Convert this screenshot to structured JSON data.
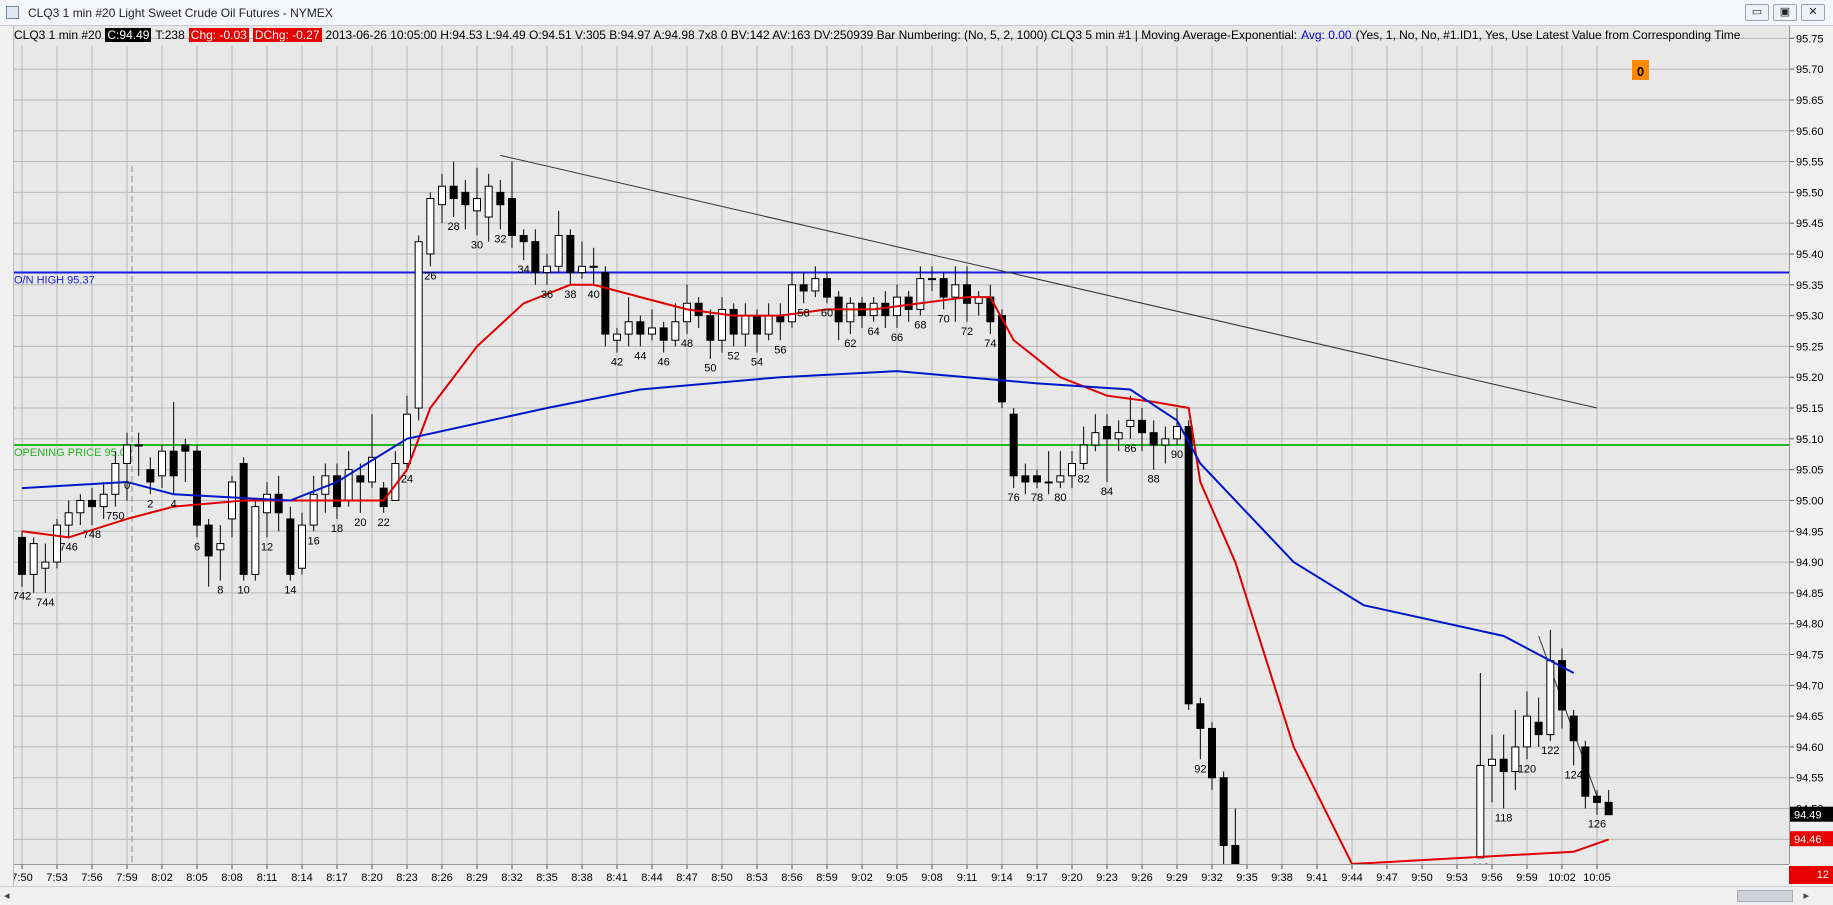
{
  "window": {
    "title": "CLQ3  1 min  #20  Light Sweet Crude Oil Futures - NYMEX",
    "buttons": {
      "minimize": "▭",
      "restore": "▣",
      "close": "✕"
    }
  },
  "infobar": {
    "symbol": "CLQ3  1 min  #20",
    "close": "C:94.49",
    "ticks": "T:238",
    "chg": "Chg: -0.03",
    "dchg": "DChg: -0.27",
    "details": "2013-06-26 10:05:00 H:94.53 L:94.49 O:94.51 V:305 B:94.97 A:94.98 7x8 0 BV:142 AV:163 DV:250939  Bar Numbering:  (No, 5, 2, 1000)  CLQ3  5 min  #1 | Moving Average-Exponential:",
    "avg": "Avg: 0.00",
    "params": "(Yes, 1, No, No, #1.ID1, Yes, Use Latest Value from Corresponding Time"
  },
  "badge": "0",
  "colors": {
    "background": "#e8e8e8",
    "ema_fast": "#e00000",
    "ema_slow": "#0018c8",
    "on_high_line": "#1a1ae0",
    "opening_line": "#22b822",
    "trendline": "#333333",
    "badge": "#ff8a00"
  },
  "price_labels": {
    "last": "94.49",
    "ema": "94.46",
    "xaxis_badge": "12"
  },
  "chart_data": {
    "type": "candlestick",
    "title": "CLQ3  1 min  #20  Light Sweet Crude Oil Futures - NYMEX",
    "ylim": [
      94.41,
      95.77
    ],
    "yticks": [
      95.75,
      95.7,
      95.65,
      95.6,
      95.55,
      95.5,
      95.45,
      95.4,
      95.35,
      95.3,
      95.25,
      95.2,
      95.15,
      95.1,
      95.05,
      95.0,
      94.95,
      94.9,
      94.85,
      94.8,
      94.75,
      94.7,
      94.65,
      94.6,
      94.55,
      94.5,
      94.45
    ],
    "xticks": [
      "7:50",
      "7:53",
      "7:56",
      "7:59",
      "8:02",
      "8:05",
      "8:08",
      "8:11",
      "8:14",
      "8:17",
      "8:20",
      "8:23",
      "8:26",
      "8:29",
      "8:32",
      "8:35",
      "8:38",
      "8:41",
      "8:44",
      "8:47",
      "8:50",
      "8:53",
      "8:56",
      "8:59",
      "9:02",
      "9:05",
      "9:08",
      "9:11",
      "9:14",
      "9:17",
      "9:20",
      "9:23",
      "9:26",
      "9:29",
      "9:32",
      "9:35",
      "9:38",
      "9:41",
      "9:44",
      "9:47",
      "9:50",
      "9:53",
      "9:56",
      "9:59",
      "10:02",
      "10:05"
    ],
    "horizontal_lines": [
      {
        "label": "O/N HIGH",
        "value": 95.37
      },
      {
        "label": "OPENING PRICE",
        "value": 95.09
      }
    ],
    "trendlines": [
      {
        "from": [
          "8:31",
          95.56
        ],
        "to": [
          "10:05",
          95.15
        ]
      },
      {
        "from": [
          "10:00",
          94.78
        ],
        "to": [
          "10:05",
          94.52
        ]
      }
    ],
    "candles": [
      [
        742,
        94.94,
        94.88,
        94.95,
        94.86
      ],
      [
        743,
        94.88,
        94.93,
        94.94,
        94.85
      ],
      [
        744,
        94.89,
        94.9,
        94.93,
        94.85
      ],
      [
        745,
        94.9,
        94.96,
        94.97,
        94.89
      ],
      [
        746,
        94.96,
        94.98,
        95.0,
        94.94
      ],
      [
        747,
        94.98,
        95.0,
        95.01,
        94.96
      ],
      [
        748,
        95.0,
        94.99,
        95.02,
        94.96
      ],
      [
        749,
        94.99,
        95.01,
        95.03,
        94.97
      ],
      [
        750,
        95.01,
        95.06,
        95.08,
        94.99
      ],
      [
        751,
        95.06,
        95.09,
        95.11,
        95.0
      ],
      [
        1,
        95.09,
        95.09,
        95.11,
        95.04
      ],
      [
        2,
        95.05,
        95.03,
        95.07,
        95.01
      ],
      [
        3,
        95.04,
        95.08,
        95.09,
        95.02
      ],
      [
        4,
        95.08,
        95.04,
        95.16,
        95.01
      ],
      [
        5,
        95.09,
        95.08,
        95.1,
        95.03
      ],
      [
        6,
        95.08,
        94.96,
        95.09,
        94.94
      ],
      [
        7,
        94.96,
        94.91,
        94.97,
        94.86
      ],
      [
        8,
        94.92,
        94.93,
        94.96,
        94.87
      ],
      [
        9,
        94.97,
        95.03,
        95.04,
        94.94
      ],
      [
        10,
        95.06,
        94.88,
        95.07,
        94.87
      ],
      [
        11,
        94.88,
        94.99,
        95.0,
        94.87
      ],
      [
        12,
        94.98,
        95.01,
        95.03,
        94.94
      ],
      [
        13,
        95.01,
        94.98,
        95.04,
        94.95
      ],
      [
        14,
        94.97,
        94.88,
        94.99,
        94.87
      ],
      [
        15,
        94.89,
        94.96,
        94.98,
        94.88
      ],
      [
        16,
        94.96,
        95.01,
        95.04,
        94.95
      ],
      [
        17,
        95.01,
        95.04,
        95.06,
        94.98
      ],
      [
        18,
        95.04,
        94.99,
        95.06,
        94.97
      ],
      [
        19,
        95.0,
        95.05,
        95.08,
        94.99
      ],
      [
        20,
        95.04,
        95.03,
        95.06,
        94.98
      ],
      [
        21,
        95.03,
        95.07,
        95.14,
        95.02
      ],
      [
        22,
        95.02,
        94.99,
        95.03,
        94.98
      ],
      [
        23,
        95.0,
        95.06,
        95.08,
        95.0
      ],
      [
        24,
        95.06,
        95.14,
        95.17,
        95.05
      ],
      [
        25,
        95.15,
        95.42,
        95.43,
        95.13
      ],
      [
        26,
        95.4,
        95.49,
        95.5,
        95.38
      ],
      [
        27,
        95.48,
        95.51,
        95.53,
        95.45
      ],
      [
        28,
        95.51,
        95.49,
        95.55,
        95.46
      ],
      [
        29,
        95.5,
        95.48,
        95.52,
        95.44
      ],
      [
        30,
        95.47,
        95.49,
        95.54,
        95.43
      ],
      [
        31,
        95.46,
        95.51,
        95.53,
        95.42
      ],
      [
        32,
        95.5,
        95.48,
        95.52,
        95.44
      ],
      [
        33,
        95.49,
        95.43,
        95.55,
        95.41
      ],
      [
        34,
        95.43,
        95.42,
        95.44,
        95.39
      ],
      [
        35,
        95.42,
        95.37,
        95.44,
        95.35
      ],
      [
        36,
        95.37,
        95.38,
        95.4,
        95.35
      ],
      [
        37,
        95.38,
        95.43,
        95.47,
        95.37
      ],
      [
        38,
        95.43,
        95.37,
        95.44,
        95.35
      ],
      [
        39,
        95.37,
        95.38,
        95.42,
        95.36
      ],
      [
        40,
        95.38,
        95.38,
        95.41,
        95.35
      ],
      [
        41,
        95.37,
        95.27,
        95.38,
        95.25
      ],
      [
        42,
        95.26,
        95.27,
        95.28,
        95.24
      ],
      [
        43,
        95.27,
        95.29,
        95.33,
        95.25
      ],
      [
        44,
        95.29,
        95.27,
        95.3,
        95.25
      ],
      [
        45,
        95.27,
        95.28,
        95.31,
        95.26
      ],
      [
        46,
        95.28,
        95.26,
        95.29,
        95.24
      ],
      [
        47,
        95.26,
        95.29,
        95.32,
        95.25
      ],
      [
        48,
        95.29,
        95.32,
        95.35,
        95.27
      ],
      [
        49,
        95.32,
        95.3,
        95.33,
        95.28
      ],
      [
        50,
        95.3,
        95.26,
        95.31,
        95.23
      ],
      [
        51,
        95.26,
        95.31,
        95.33,
        95.24
      ],
      [
        52,
        95.31,
        95.27,
        95.32,
        95.25
      ],
      [
        53,
        95.27,
        95.3,
        95.32,
        95.25
      ],
      [
        54,
        95.3,
        95.27,
        95.31,
        95.24
      ],
      [
        55,
        95.27,
        95.3,
        95.32,
        95.26
      ],
      [
        56,
        95.3,
        95.29,
        95.32,
        95.26
      ],
      [
        57,
        95.29,
        95.35,
        95.37,
        95.28
      ],
      [
        58,
        95.35,
        95.34,
        95.37,
        95.32
      ],
      [
        59,
        95.34,
        95.36,
        95.38,
        95.33
      ],
      [
        60,
        95.36,
        95.33,
        95.37,
        95.32
      ],
      [
        61,
        95.33,
        95.29,
        95.34,
        95.26
      ],
      [
        62,
        95.29,
        95.32,
        95.33,
        95.27
      ],
      [
        63,
        95.32,
        95.3,
        95.33,
        95.28
      ],
      [
        64,
        95.3,
        95.32,
        95.33,
        95.29
      ],
      [
        65,
        95.32,
        95.3,
        95.34,
        95.28
      ],
      [
        66,
        95.3,
        95.33,
        95.35,
        95.28
      ],
      [
        67,
        95.33,
        95.31,
        95.34,
        95.29
      ],
      [
        68,
        95.31,
        95.36,
        95.38,
        95.3
      ],
      [
        69,
        95.36,
        95.36,
        95.38,
        95.34
      ],
      [
        70,
        95.36,
        95.33,
        95.37,
        95.31
      ],
      [
        71,
        95.33,
        95.35,
        95.38,
        95.29
      ],
      [
        72,
        95.35,
        95.32,
        95.38,
        95.29
      ],
      [
        73,
        95.32,
        95.33,
        95.34,
        95.3
      ],
      [
        74,
        95.33,
        95.29,
        95.35,
        95.27
      ],
      [
        75,
        95.3,
        95.16,
        95.31,
        95.15
      ],
      [
        76,
        95.14,
        95.04,
        95.15,
        95.02
      ],
      [
        77,
        95.04,
        95.03,
        95.06,
        95.01
      ],
      [
        78,
        95.04,
        95.03,
        95.05,
        95.02
      ],
      [
        79,
        95.03,
        95.03,
        95.08,
        95.01
      ],
      [
        80,
        95.03,
        95.04,
        95.08,
        95.02
      ],
      [
        81,
        95.04,
        95.06,
        95.08,
        95.02
      ],
      [
        82,
        95.06,
        95.09,
        95.12,
        95.05
      ],
      [
        83,
        95.09,
        95.11,
        95.14,
        95.08
      ],
      [
        84,
        95.12,
        95.1,
        95.14,
        95.03
      ],
      [
        85,
        95.1,
        95.11,
        95.13,
        95.08
      ],
      [
        86,
        95.12,
        95.13,
        95.17,
        95.1
      ],
      [
        87,
        95.13,
        95.11,
        95.15,
        95.08
      ],
      [
        88,
        95.11,
        95.09,
        95.13,
        95.05
      ],
      [
        89,
        95.09,
        95.1,
        95.12,
        95.06
      ],
      [
        90,
        95.1,
        95.12,
        95.15,
        95.09
      ],
      [
        91,
        95.12,
        94.67,
        95.13,
        94.66
      ],
      [
        92,
        94.67,
        94.63,
        94.68,
        94.58
      ],
      [
        93,
        94.63,
        94.55,
        94.64,
        94.53
      ],
      [
        94,
        94.55,
        94.44,
        94.56,
        94.41
      ],
      [
        95,
        94.44,
        94.41,
        94.5,
        94.41
      ],
      [
        116,
        94.42,
        94.57,
        94.72,
        94.42
      ],
      [
        117,
        94.57,
        94.58,
        94.62,
        94.51
      ],
      [
        118,
        94.58,
        94.56,
        94.62,
        94.5
      ],
      [
        119,
        94.56,
        94.6,
        94.66,
        94.53
      ],
      [
        120,
        94.6,
        94.65,
        94.69,
        94.58
      ],
      [
        121,
        94.64,
        94.62,
        94.68,
        94.6
      ],
      [
        122,
        94.62,
        94.74,
        94.79,
        94.61
      ],
      [
        123,
        94.74,
        94.66,
        94.76,
        94.63
      ],
      [
        124,
        94.65,
        94.61,
        94.66,
        94.57
      ],
      [
        125,
        94.6,
        94.52,
        94.61,
        94.5
      ],
      [
        126,
        94.52,
        94.51,
        94.53,
        94.49
      ],
      [
        127,
        94.51,
        94.49,
        94.53,
        94.49
      ]
    ],
    "candle_columns": [
      "bar",
      "open",
      "close",
      "high",
      "low"
    ],
    "bar_labels": [
      "0",
      "742",
      "744",
      "746",
      "748",
      "750",
      "2",
      "4",
      "6",
      "8",
      "10",
      "12",
      "14",
      "16",
      "18",
      "20",
      "22",
      "24",
      "26",
      "28",
      "30",
      "32",
      "34",
      "36",
      "38",
      "40",
      "42",
      "44",
      "46",
      "48",
      "50",
      "52",
      "54",
      "56",
      "58",
      "60",
      "62",
      "64",
      "66",
      "68",
      "70",
      "72",
      "74",
      "76",
      "78",
      "80",
      "82",
      "84",
      "86",
      "88",
      "90",
      "92",
      "116",
      "118",
      "120",
      "122",
      "124",
      "126"
    ],
    "series": [
      {
        "name": "EMA",
        "color": "#e00000",
        "values": [
          [
            742,
            94.95
          ],
          [
            746,
            94.94
          ],
          [
            751,
            94.97
          ],
          [
            4,
            94.99
          ],
          [
            10,
            95.0
          ],
          [
            14,
            95.0
          ],
          [
            18,
            95.0
          ],
          [
            22,
            95.0
          ],
          [
            24,
            95.05
          ],
          [
            26,
            95.15
          ],
          [
            30,
            95.25
          ],
          [
            34,
            95.32
          ],
          [
            38,
            95.35
          ],
          [
            40,
            95.35
          ],
          [
            44,
            95.33
          ],
          [
            48,
            95.31
          ],
          [
            52,
            95.3
          ],
          [
            56,
            95.3
          ],
          [
            60,
            95.31
          ],
          [
            64,
            95.31
          ],
          [
            68,
            95.32
          ],
          [
            72,
            95.33
          ],
          [
            74,
            95.33
          ],
          [
            76,
            95.26
          ],
          [
            80,
            95.2
          ],
          [
            84,
            95.17
          ],
          [
            88,
            95.16
          ],
          [
            91,
            95.15
          ],
          [
            92,
            95.03
          ],
          [
            95,
            94.9
          ],
          [
            100,
            94.6
          ],
          [
            105,
            94.41
          ],
          [
            124,
            94.43
          ],
          [
            127,
            94.45
          ]
        ]
      },
      {
        "name": "EMA 5 min",
        "color": "#0018c8",
        "values": [
          [
            742,
            95.02
          ],
          [
            751,
            95.03
          ],
          [
            4,
            95.01
          ],
          [
            14,
            95.0
          ],
          [
            18,
            95.03
          ],
          [
            24,
            95.1
          ],
          [
            36,
            95.15
          ],
          [
            44,
            95.18
          ],
          [
            56,
            95.2
          ],
          [
            66,
            95.21
          ],
          [
            72,
            95.2
          ],
          [
            78,
            95.19
          ],
          [
            86,
            95.18
          ],
          [
            90,
            95.13
          ],
          [
            92,
            95.06
          ],
          [
            100,
            94.9
          ],
          [
            106,
            94.83
          ],
          [
            118,
            94.78
          ],
          [
            124,
            94.72
          ]
        ]
      }
    ]
  }
}
